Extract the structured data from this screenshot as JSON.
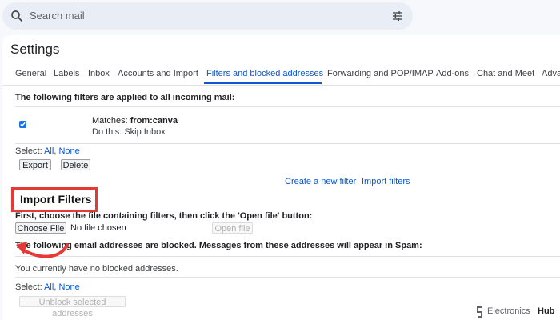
{
  "search": {
    "placeholder": "Search mail"
  },
  "settings": {
    "title": "Settings"
  },
  "tabs": [
    {
      "label": "General"
    },
    {
      "label": "Labels"
    },
    {
      "label": "Inbox"
    },
    {
      "label": "Accounts and Import"
    },
    {
      "label": "Filters and blocked addresses",
      "active": true
    },
    {
      "label": "Forwarding and POP/IMAP"
    },
    {
      "label": "Add-ons"
    },
    {
      "label": "Chat and Meet"
    },
    {
      "label": "Adva"
    }
  ],
  "filters": {
    "heading": "The following filters are applied to all incoming mail:",
    "items": [
      {
        "matches_label": "Matches: ",
        "matches_value": "from:canva",
        "do_this": "Do this: Skip Inbox",
        "checked": true
      }
    ],
    "select_label": "Select: ",
    "select_all": "All",
    "select_sep": ", ",
    "select_none": "None",
    "export_label": "Export",
    "delete_label": "Delete",
    "create_filter": "Create a new filter",
    "import_filters": "Import filters"
  },
  "import": {
    "title": "Import Filters",
    "instruction": "First, choose the file containing filters, then click the 'Open file' button:",
    "choose_file": "Choose File",
    "no_file": "No file chosen",
    "open_file": "Open file"
  },
  "blocked": {
    "heading": "The following email addresses are blocked. Messages from these addresses will appear in Spam:",
    "empty": "You currently have no blocked addresses.",
    "select_label": "Select: ",
    "select_all": "All",
    "select_sep": ", ",
    "select_none": "None",
    "unblock": "Unblock selected addresses"
  },
  "watermark": {
    "part1": "Electronics",
    "part2": "Hub"
  },
  "colors": {
    "accent": "#0b57d0",
    "annotation": "#e53935"
  },
  "icons": [
    "search-icon",
    "tune-icon",
    "checkbox-checked-icon",
    "annotation-arrow-icon",
    "electronics-hub-logo-icon"
  ]
}
